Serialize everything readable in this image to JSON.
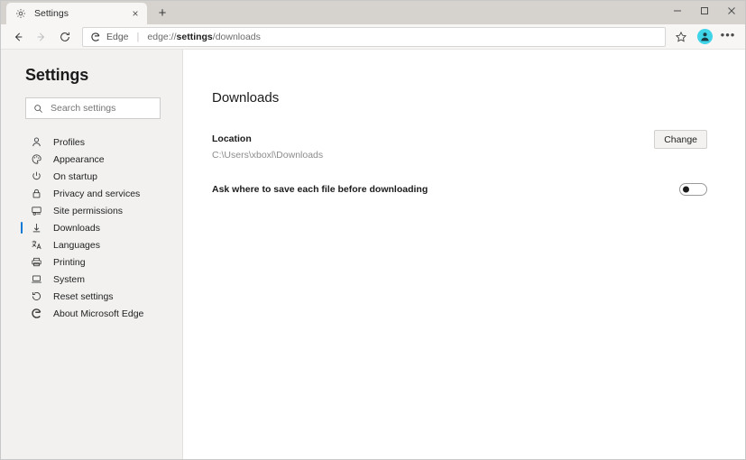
{
  "window": {
    "controls": {
      "minimize": "minimize-button",
      "maximize": "maximize-button",
      "close": "close-button"
    }
  },
  "tabstrip": {
    "tabs": [
      {
        "title": "Settings",
        "favicon": "gear-icon",
        "close_label": "×"
      }
    ],
    "new_tab_label": "+"
  },
  "toolbar": {
    "back": "back-icon",
    "forward": "forward-icon",
    "refresh": "refresh-icon",
    "brand": "Edge",
    "separator": "|",
    "url_prefix": "edge://",
    "url_bold": "settings",
    "url_suffix": "/downloads",
    "favorites": "star-icon",
    "profile": "profile-avatar",
    "more": "•••"
  },
  "sidebar": {
    "title": "Settings",
    "search": {
      "placeholder": "Search settings",
      "value": "",
      "icon": "search-icon"
    },
    "items": [
      {
        "label": "Profiles",
        "icon": "person-icon",
        "selected": false
      },
      {
        "label": "Appearance",
        "icon": "palette-icon",
        "selected": false
      },
      {
        "label": "On startup",
        "icon": "power-icon",
        "selected": false
      },
      {
        "label": "Privacy and services",
        "icon": "lock-icon",
        "selected": false
      },
      {
        "label": "Site permissions",
        "icon": "site-permissions-icon",
        "selected": false
      },
      {
        "label": "Downloads",
        "icon": "download-arrow-icon",
        "selected": true
      },
      {
        "label": "Languages",
        "icon": "languages-icon",
        "selected": false
      },
      {
        "label": "Printing",
        "icon": "printer-icon",
        "selected": false
      },
      {
        "label": "System",
        "icon": "laptop-icon",
        "selected": false
      },
      {
        "label": "Reset settings",
        "icon": "reset-icon",
        "selected": false
      },
      {
        "label": "About Microsoft Edge",
        "icon": "edge-logo-icon",
        "selected": false
      }
    ]
  },
  "main": {
    "page_title": "Downloads",
    "location": {
      "label": "Location",
      "path": "C:\\Users\\xboxl\\Downloads",
      "button_label": "Change"
    },
    "ask_where": {
      "label": "Ask where to save each file before downloading",
      "toggle_state": "off"
    }
  },
  "colors": {
    "accent": "#0078d4",
    "avatar": "#3fd4e8",
    "sidebar_bg": "#f2f1f0",
    "tabstrip_bg": "#d6d2ce"
  }
}
